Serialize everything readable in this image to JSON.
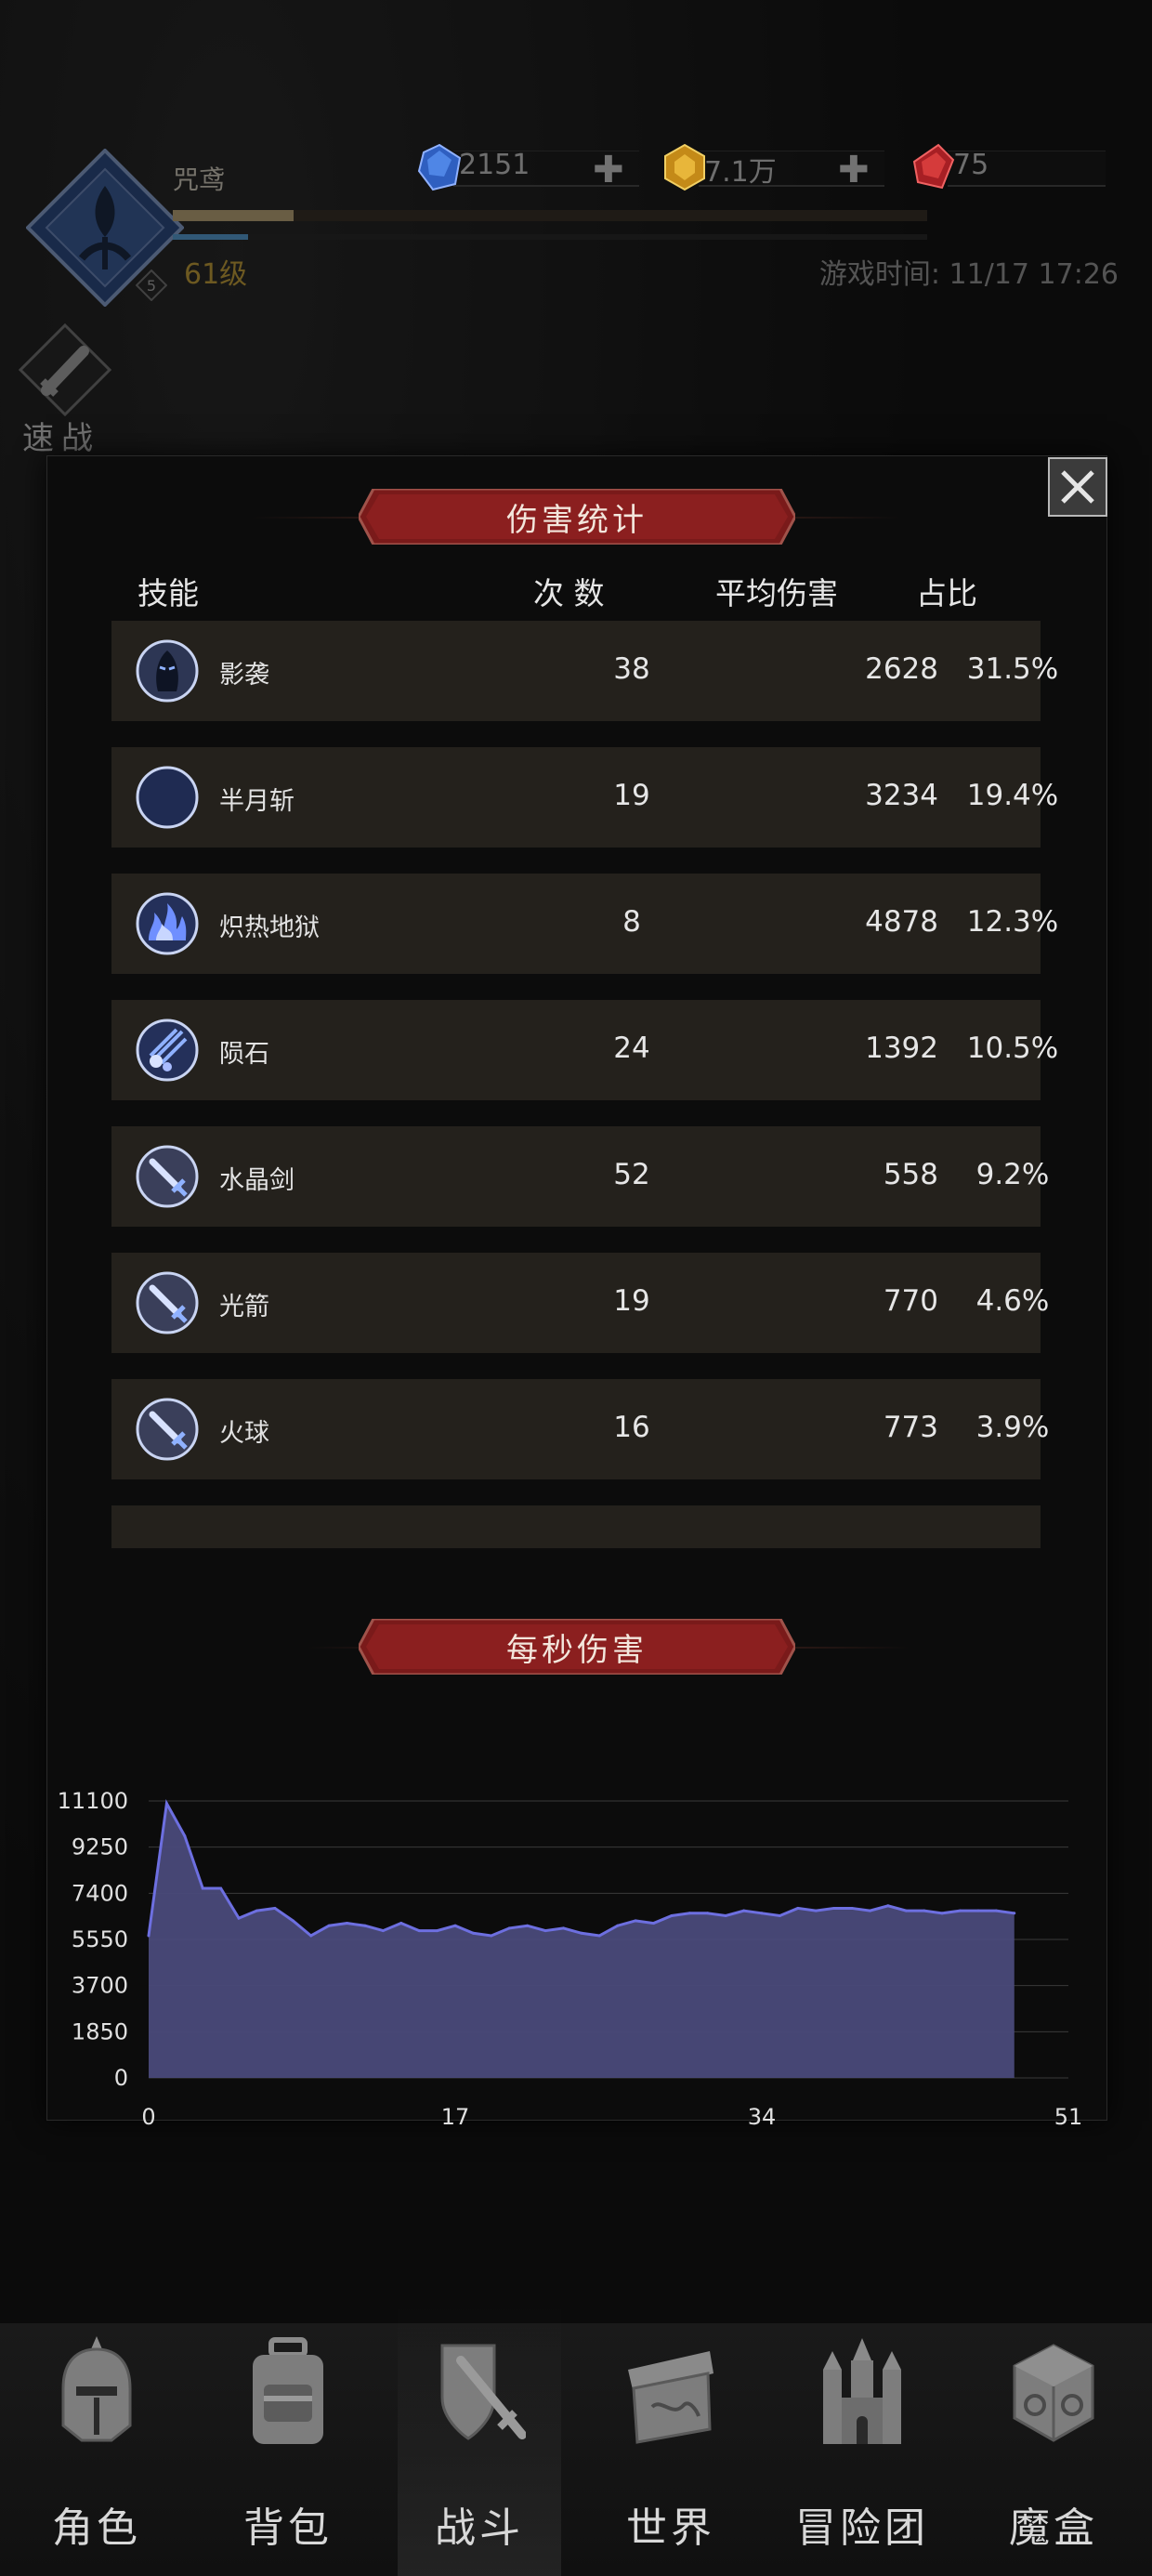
{
  "player": {
    "name": "咒鸢",
    "level_text": "61级",
    "rank_badge": "5",
    "xp_fraction": 0.16,
    "mp_fraction": 0.1
  },
  "currencies": [
    {
      "name": "blue-gem",
      "value": "2151",
      "color": "#3f6ed1"
    },
    {
      "name": "gold-gem",
      "value": "7.1万",
      "color": "#d7a32b"
    },
    {
      "name": "red-gem",
      "value": "75",
      "color": "#c33131"
    }
  ],
  "game_time": "游戏时间: 11/17 17:26",
  "quick_battle": "速战",
  "damage_stats": {
    "title": "伤害统计",
    "headers": {
      "skill": "技能",
      "count": "次 数",
      "avg": "平均伤害",
      "share": "占比"
    },
    "rows": [
      {
        "skill": "影袭",
        "icon": "shadow-strike-icon",
        "count": "38",
        "avg": "2628",
        "share": "31.5%"
      },
      {
        "skill": "半月斩",
        "icon": "half-moon-slash-icon",
        "count": "19",
        "avg": "3234",
        "share": "19.4%"
      },
      {
        "skill": "炽热地狱",
        "icon": "blazing-inferno-icon",
        "count": "8",
        "avg": "4878",
        "share": "12.3%"
      },
      {
        "skill": "陨石",
        "icon": "meteor-icon",
        "count": "24",
        "avg": "1392",
        "share": "10.5%"
      },
      {
        "skill": "水晶剑",
        "icon": "crystal-sword-icon",
        "count": "52",
        "avg": "558",
        "share": "9.2%"
      },
      {
        "skill": "光箭",
        "icon": "light-arrow-icon",
        "count": "19",
        "avg": "770",
        "share": "4.6%"
      },
      {
        "skill": "火球",
        "icon": "fireball-icon",
        "count": "16",
        "avg": "773",
        "share": "3.9%"
      }
    ]
  },
  "dps": {
    "title": "每秒伤害"
  },
  "chart_data": {
    "type": "area",
    "title": "每秒伤害",
    "xlabel": "",
    "ylabel": "",
    "xlim": [
      0,
      51
    ],
    "ylim": [
      0,
      11100
    ],
    "x_ticks": [
      0,
      17,
      34,
      51
    ],
    "y_ticks": [
      0,
      1850,
      3700,
      5550,
      7400,
      9250,
      11100
    ],
    "grid": true,
    "color": "#4a4a7a",
    "line_color": "#6d6fe0",
    "x": [
      0,
      1,
      2,
      3,
      4,
      5,
      6,
      7,
      8,
      9,
      10,
      11,
      12,
      13,
      14,
      15,
      16,
      17,
      18,
      19,
      20,
      21,
      22,
      23,
      24,
      25,
      26,
      27,
      28,
      29,
      30,
      31,
      32,
      33,
      34,
      35,
      36,
      37,
      38,
      39,
      40,
      41,
      42,
      43,
      44,
      45,
      46,
      47,
      48
    ],
    "values": [
      5700,
      11000,
      9700,
      7600,
      7600,
      6400,
      6700,
      6800,
      6300,
      5700,
      6100,
      6200,
      6100,
      5900,
      6200,
      5900,
      5900,
      6100,
      5800,
      5700,
      6000,
      6100,
      5900,
      6000,
      5800,
      5700,
      6100,
      6300,
      6200,
      6500,
      6600,
      6600,
      6500,
      6700,
      6600,
      6500,
      6800,
      6700,
      6800,
      6800,
      6700,
      6900,
      6700,
      6700,
      6600,
      6700,
      6700,
      6700,
      6600
    ]
  },
  "nav": [
    {
      "label": "角色",
      "icon": "character-helmet-icon"
    },
    {
      "label": "背包",
      "icon": "backpack-icon"
    },
    {
      "label": "战斗",
      "icon": "battle-shield-sword-icon"
    },
    {
      "label": "世界",
      "icon": "world-map-scroll-icon"
    },
    {
      "label": "冒险团",
      "icon": "castle-guild-icon"
    },
    {
      "label": "魔盒",
      "icon": "magic-box-icon"
    }
  ]
}
